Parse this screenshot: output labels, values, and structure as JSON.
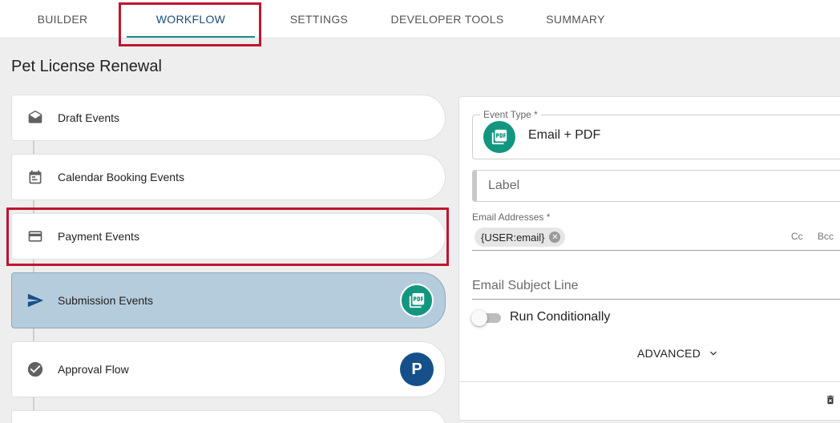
{
  "tabs": [
    {
      "label": "BUILDER"
    },
    {
      "label": "WORKFLOW"
    },
    {
      "label": "SETTINGS"
    },
    {
      "label": "DEVELOPER TOOLS"
    },
    {
      "label": "SUMMARY"
    }
  ],
  "active_tab": "WORKFLOW",
  "page_title": "Pet License Renewal",
  "events": [
    {
      "label": "Draft Events",
      "icon": "envelope-open-icon"
    },
    {
      "label": "Calendar Booking Events",
      "icon": "calendar-icon"
    },
    {
      "label": "Payment Events",
      "icon": "credit-card-icon"
    },
    {
      "label": "Submission Events",
      "icon": "send-icon",
      "badge": "pdf-icon"
    },
    {
      "label": "Approval Flow",
      "icon": "check-circle-icon",
      "badge": "P"
    }
  ],
  "editor": {
    "event_type_label": "Event Type *",
    "event_type_value": "Email + PDF",
    "label_placeholder": "Label",
    "email_addresses_label": "Email Addresses *",
    "email_chip": "{USER:email}",
    "cc": "Cc",
    "bcc": "Bcc",
    "subject_placeholder": "Email Subject Line",
    "run_conditionally": "Run Conditionally",
    "run_conditionally_on": false,
    "advanced": "ADVANCED"
  },
  "colors": {
    "accent_teal": "#12967f",
    "active_tab_text": "#1a4d7a",
    "selected_card": "#b5ccdc",
    "highlight_red": "#c0152f",
    "avatar_blue": "#15508a"
  }
}
